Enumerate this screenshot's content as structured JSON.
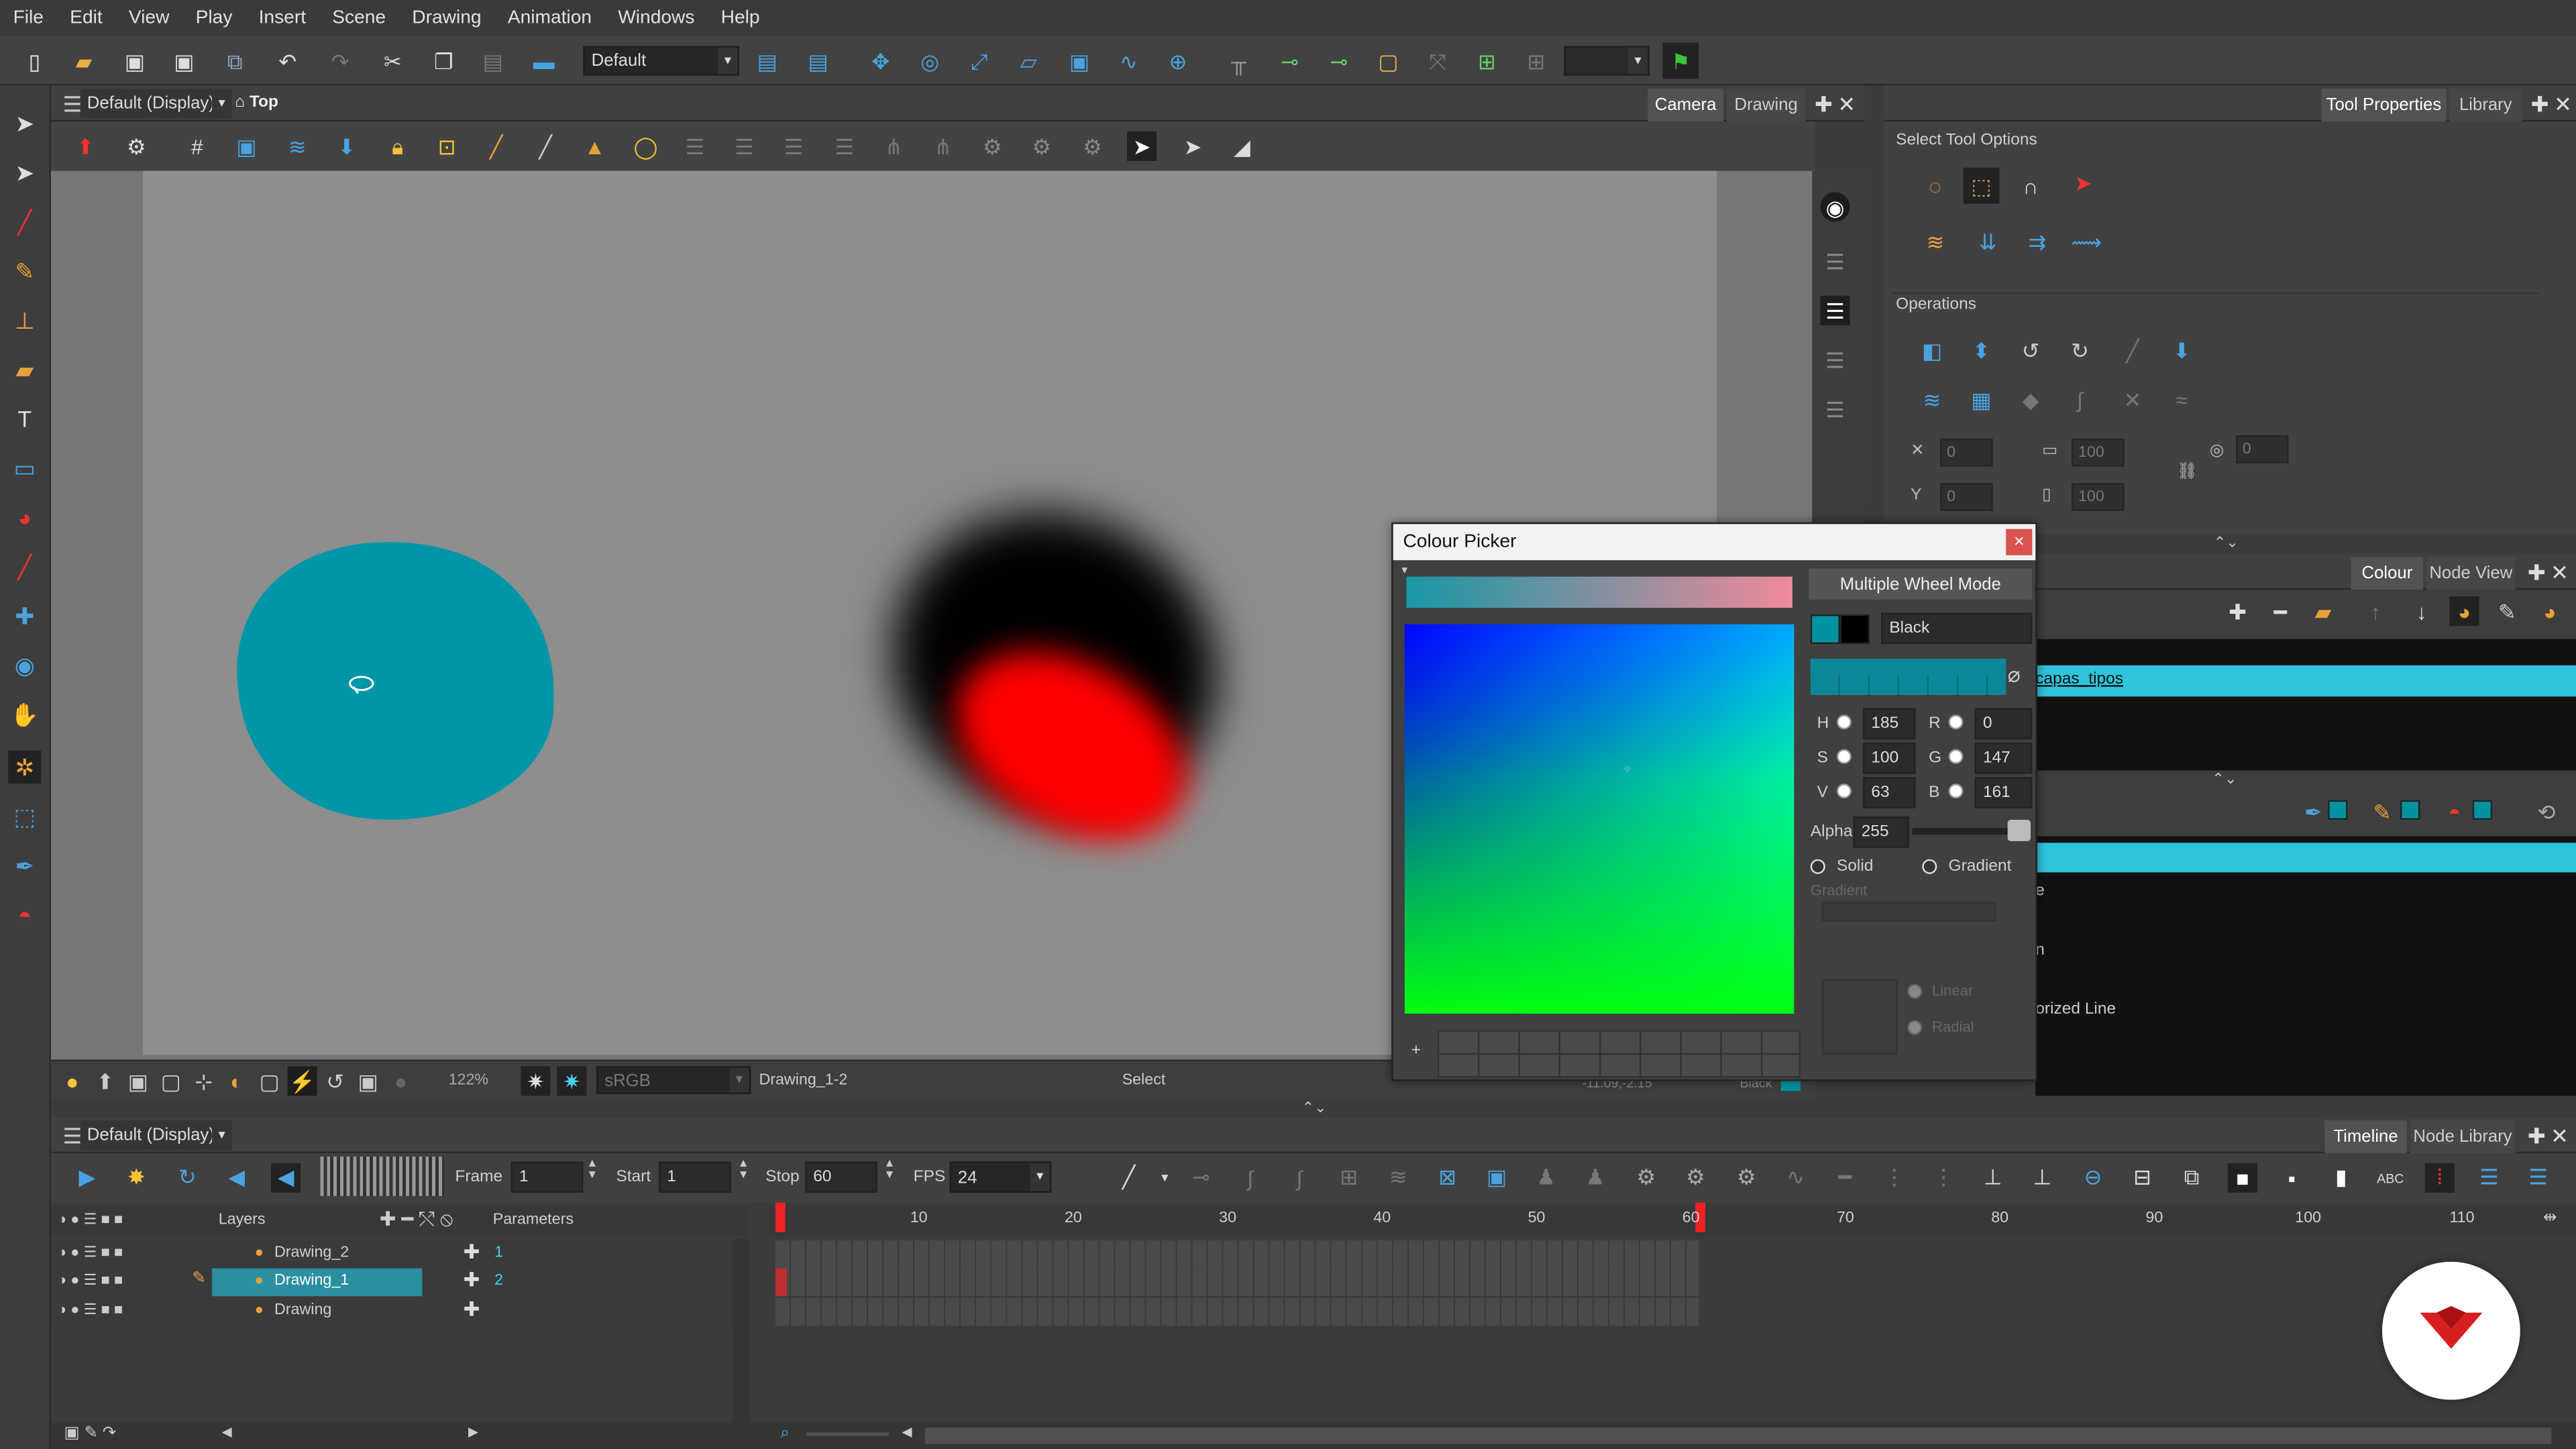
{
  "menu": [
    "File",
    "Edit",
    "View",
    "Play",
    "Insert",
    "Scene",
    "Drawing",
    "Animation",
    "Windows",
    "Help"
  ],
  "toolbar": {
    "workspace": "Default",
    "colors": {
      "accent": "#009aa8",
      "green": "#3ac43a"
    }
  },
  "camera_view": {
    "view_combo": "Default (Display)",
    "view_name": "Top",
    "tabs": [
      "Camera",
      "Drawing"
    ],
    "zoom": "122%",
    "color_space": "sRGB",
    "drawing_name": "Drawing_1-2",
    "tool_name": "Select",
    "coords": "-11.09,-2.15",
    "pos_label": "Black"
  },
  "tool_properties": {
    "tabs": [
      "Tool Properties",
      "Library"
    ],
    "select_options_title": "Select Tool Options",
    "operations_title": "Operations",
    "fields": {
      "x": "0",
      "y": "0",
      "w": "100",
      "h": "100",
      "angle": "0"
    }
  },
  "colour_panel": {
    "tabs": [
      "Colour",
      "Node View"
    ],
    "palette_name": "capas_tipos",
    "swatch_fragment": "e",
    "swatch_fragment2": "n",
    "swatch_last": "orized Line"
  },
  "colour_picker": {
    "title": "Colour Picker",
    "close": "×",
    "mode_button": "Multiple Wheel Mode",
    "color_name": "Black",
    "h": "185",
    "s": "100",
    "v": "63",
    "r": "0",
    "g": "147",
    "b": "161",
    "alpha_label": "Alpha",
    "alpha": "255",
    "solid": "Solid",
    "gradient": "Gradient",
    "gradient_label": "Gradient",
    "linear": "Linear",
    "radial": "Radial",
    "plus": "+",
    "labels": {
      "h": "H",
      "s": "S",
      "v": "V",
      "r": "R",
      "g": "G",
      "b": "B"
    },
    "current_color": "#0093a1"
  },
  "timeline": {
    "view_combo": "Default (Display)",
    "tabs": [
      "Timeline",
      "Node Library"
    ],
    "frame_label": "Frame",
    "frame": "1",
    "start_label": "Start",
    "start": "1",
    "stop_label": "Stop",
    "stop": "60",
    "fps_label": "FPS",
    "fps": "24",
    "layers_header": "Layers",
    "params_header": "Parameters",
    "layers": [
      {
        "name": "Drawing_2",
        "param": "1"
      },
      {
        "name": "Drawing_1",
        "param": "2"
      },
      {
        "name": "Drawing",
        "param": ""
      }
    ],
    "ruler": [
      "10",
      "20",
      "30",
      "40",
      "50",
      "60",
      "70",
      "80",
      "90",
      "100",
      "110"
    ]
  }
}
